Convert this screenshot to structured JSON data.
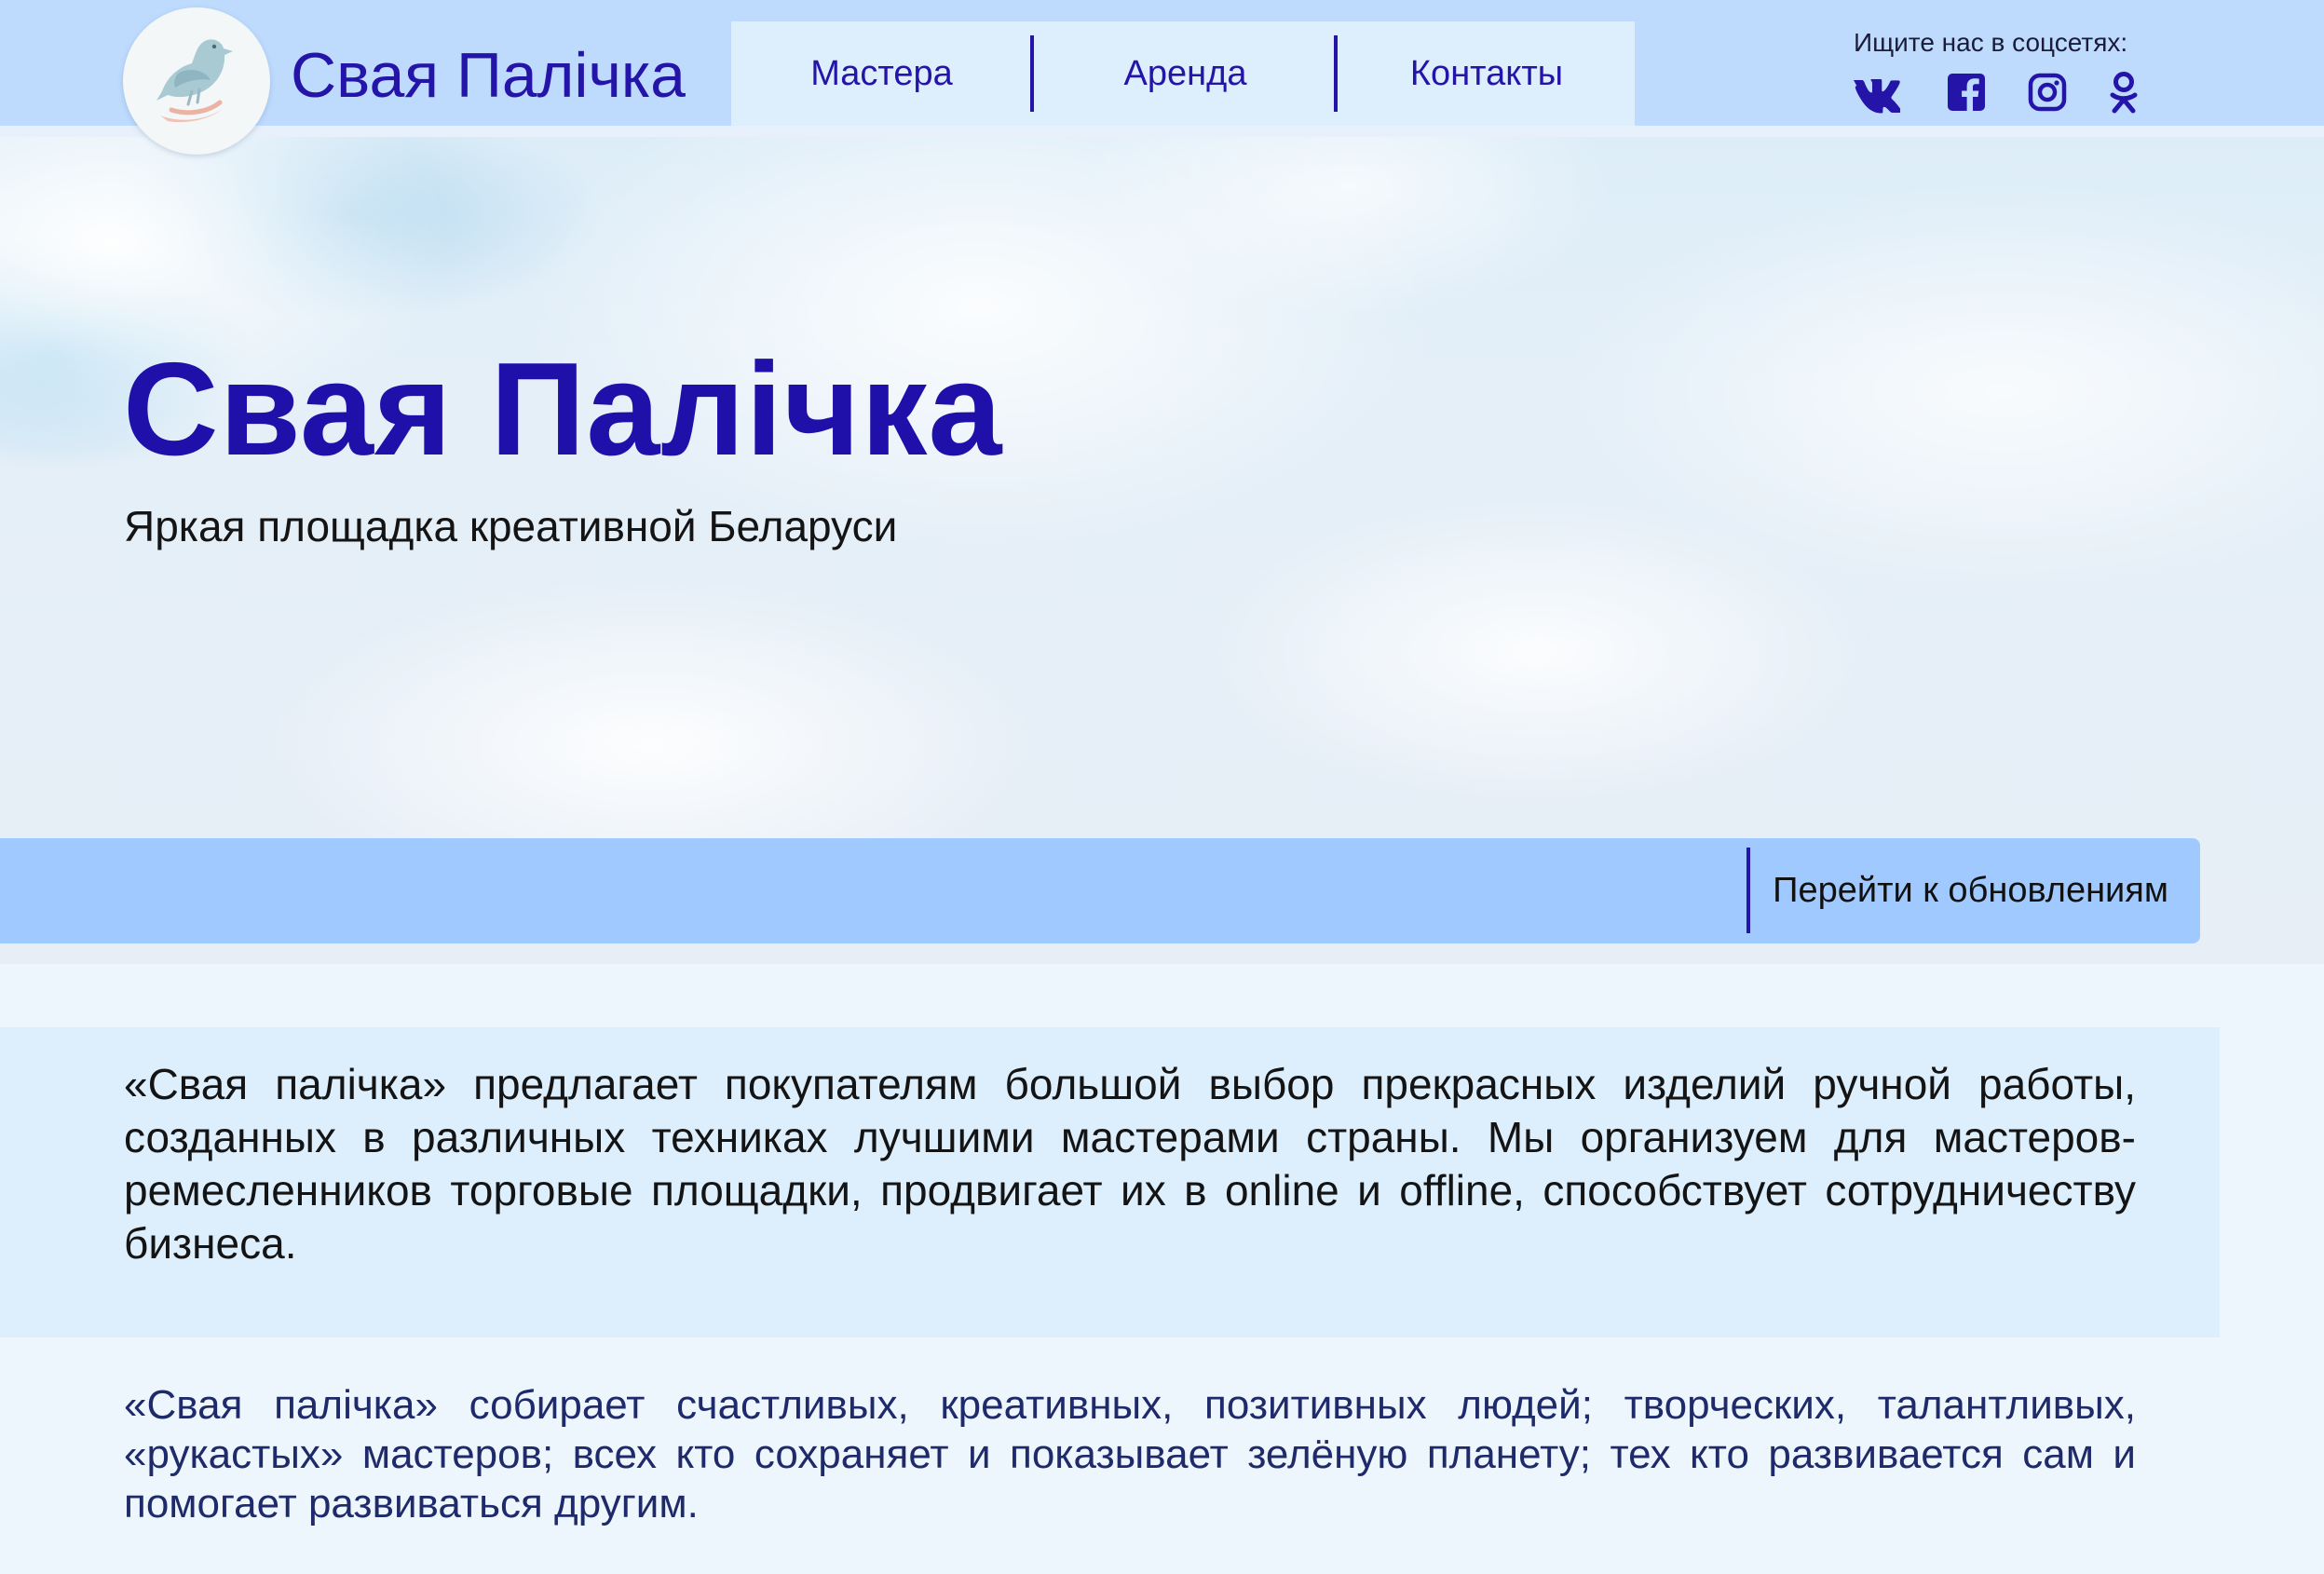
{
  "colors": {
    "header_bg": "#bedbfe",
    "nav_bg": "#ddeefd",
    "accent": "#2414a8",
    "updates_bar": "#a0caff",
    "about_bg": "#ddeffd",
    "page_bg": "#eef6fd"
  },
  "header": {
    "logo_icon": "dove-icon",
    "brand": "Свая Палічка",
    "nav": [
      {
        "label": "Мастера"
      },
      {
        "label": "Аренда"
      },
      {
        "label": "Контакты"
      }
    ],
    "social_label": "Ищите нас в соцсетях:",
    "social_icons": [
      "vk-icon",
      "facebook-icon",
      "instagram-icon",
      "odnoklassniki-icon"
    ]
  },
  "hero": {
    "title": "Свая Палічка",
    "subtitle": "Яркая площадка креативной Беларуси"
  },
  "updates": {
    "link_label": "Перейти к обновлениям"
  },
  "content": {
    "about": "«Свая палічка» предлагает покупателям большой выбор прекрасных изделий ручной ра­боты, созданных в различных техниках лучшими мастерами страны. Мы организуем для мастеров-ремесленников торговые площадки, продвигает их в online и offline, способствует сотрудничеству бизнеса.",
    "community": "«Свая палічка» собирает счастливых, креативных, позитивных людей; творческих, талантливых, «рукастых» мастеров; всех кто сохраняет и показывает зелёную планету; тех кто развивается сам и помогает развиваться другим."
  }
}
